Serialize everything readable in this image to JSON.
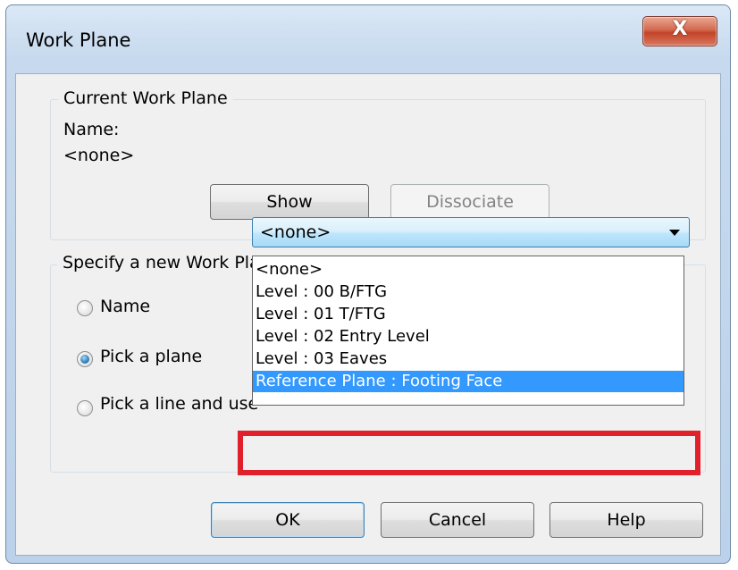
{
  "window": {
    "title": "Work Plane",
    "close_label": "X"
  },
  "current_group": {
    "legend": "Current Work Plane",
    "name_label": "Name:",
    "name_value": "<none>",
    "show_label": "Show",
    "dissociate_label": "Dissociate"
  },
  "specify_group": {
    "legend": "Specify a new Work Plane",
    "options": [
      {
        "label": "Name",
        "checked": false
      },
      {
        "label": "Pick a plane",
        "checked": true
      },
      {
        "label": "Pick a line and use",
        "checked": false
      }
    ],
    "combo_value": "<none>",
    "dropdown_items": [
      "<none>",
      "Level : 00 B/FTG",
      "Level : 01 T/FTG",
      "Level : 02 Entry Level",
      "Level : 03 Eaves"
    ],
    "selected_item": "Reference Plane : Footing Face"
  },
  "footer": {
    "ok_label": "OK",
    "cancel_label": "Cancel",
    "help_label": "Help"
  },
  "colors": {
    "highlight": "#e0202a",
    "selection": "#3399ff"
  }
}
